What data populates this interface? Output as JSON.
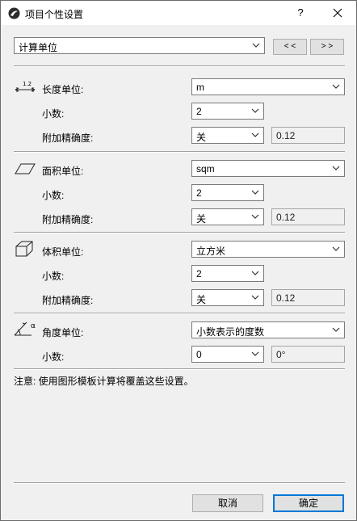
{
  "window": {
    "title": "项目个性设置",
    "help": "?"
  },
  "top": {
    "category": "计算单位",
    "prev": "< <",
    "next": "> >"
  },
  "length": {
    "icon_text": "1.2",
    "label": "长度单位:",
    "unit": "m",
    "decimals_label": "小数:",
    "decimals": "2",
    "extra_label": "附加精确度:",
    "extra": "关",
    "preview": "0.12"
  },
  "area": {
    "label": "面积单位:",
    "unit": "sqm",
    "decimals_label": "小数:",
    "decimals": "2",
    "extra_label": "附加精确度:",
    "extra": "关",
    "preview": "0.12"
  },
  "volume": {
    "label": "体积单位:",
    "unit": "立方米",
    "decimals_label": "小数:",
    "decimals": "2",
    "extra_label": "附加精确度:",
    "extra": "关",
    "preview": "0.12"
  },
  "angle": {
    "icon_text": "α",
    "label": "角度单位:",
    "unit": "小数表示的度数",
    "decimals_label": "小数:",
    "decimals": "0",
    "preview": "0°"
  },
  "note": "注意: 使用图形模板计算将覆盖这些设置。",
  "footer": {
    "cancel": "取消",
    "ok": "确定"
  }
}
